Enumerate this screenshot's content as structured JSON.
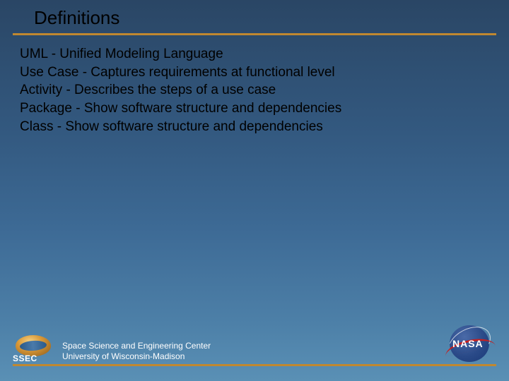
{
  "title": "Definitions",
  "definitions": [
    "UML - Unified Modeling Language",
    "Use Case - Captures requirements at functional level",
    "Activity  - Describes the steps of a use case",
    "Package - Show software structure and dependencies",
    "Class  - Show software structure and dependencies"
  ],
  "footer": {
    "org_line1": "Space Science and Engineering Center",
    "org_line2": "University of Wisconsin-Madison",
    "ssec_label": "SSEC",
    "nasa_label": "NASA"
  }
}
